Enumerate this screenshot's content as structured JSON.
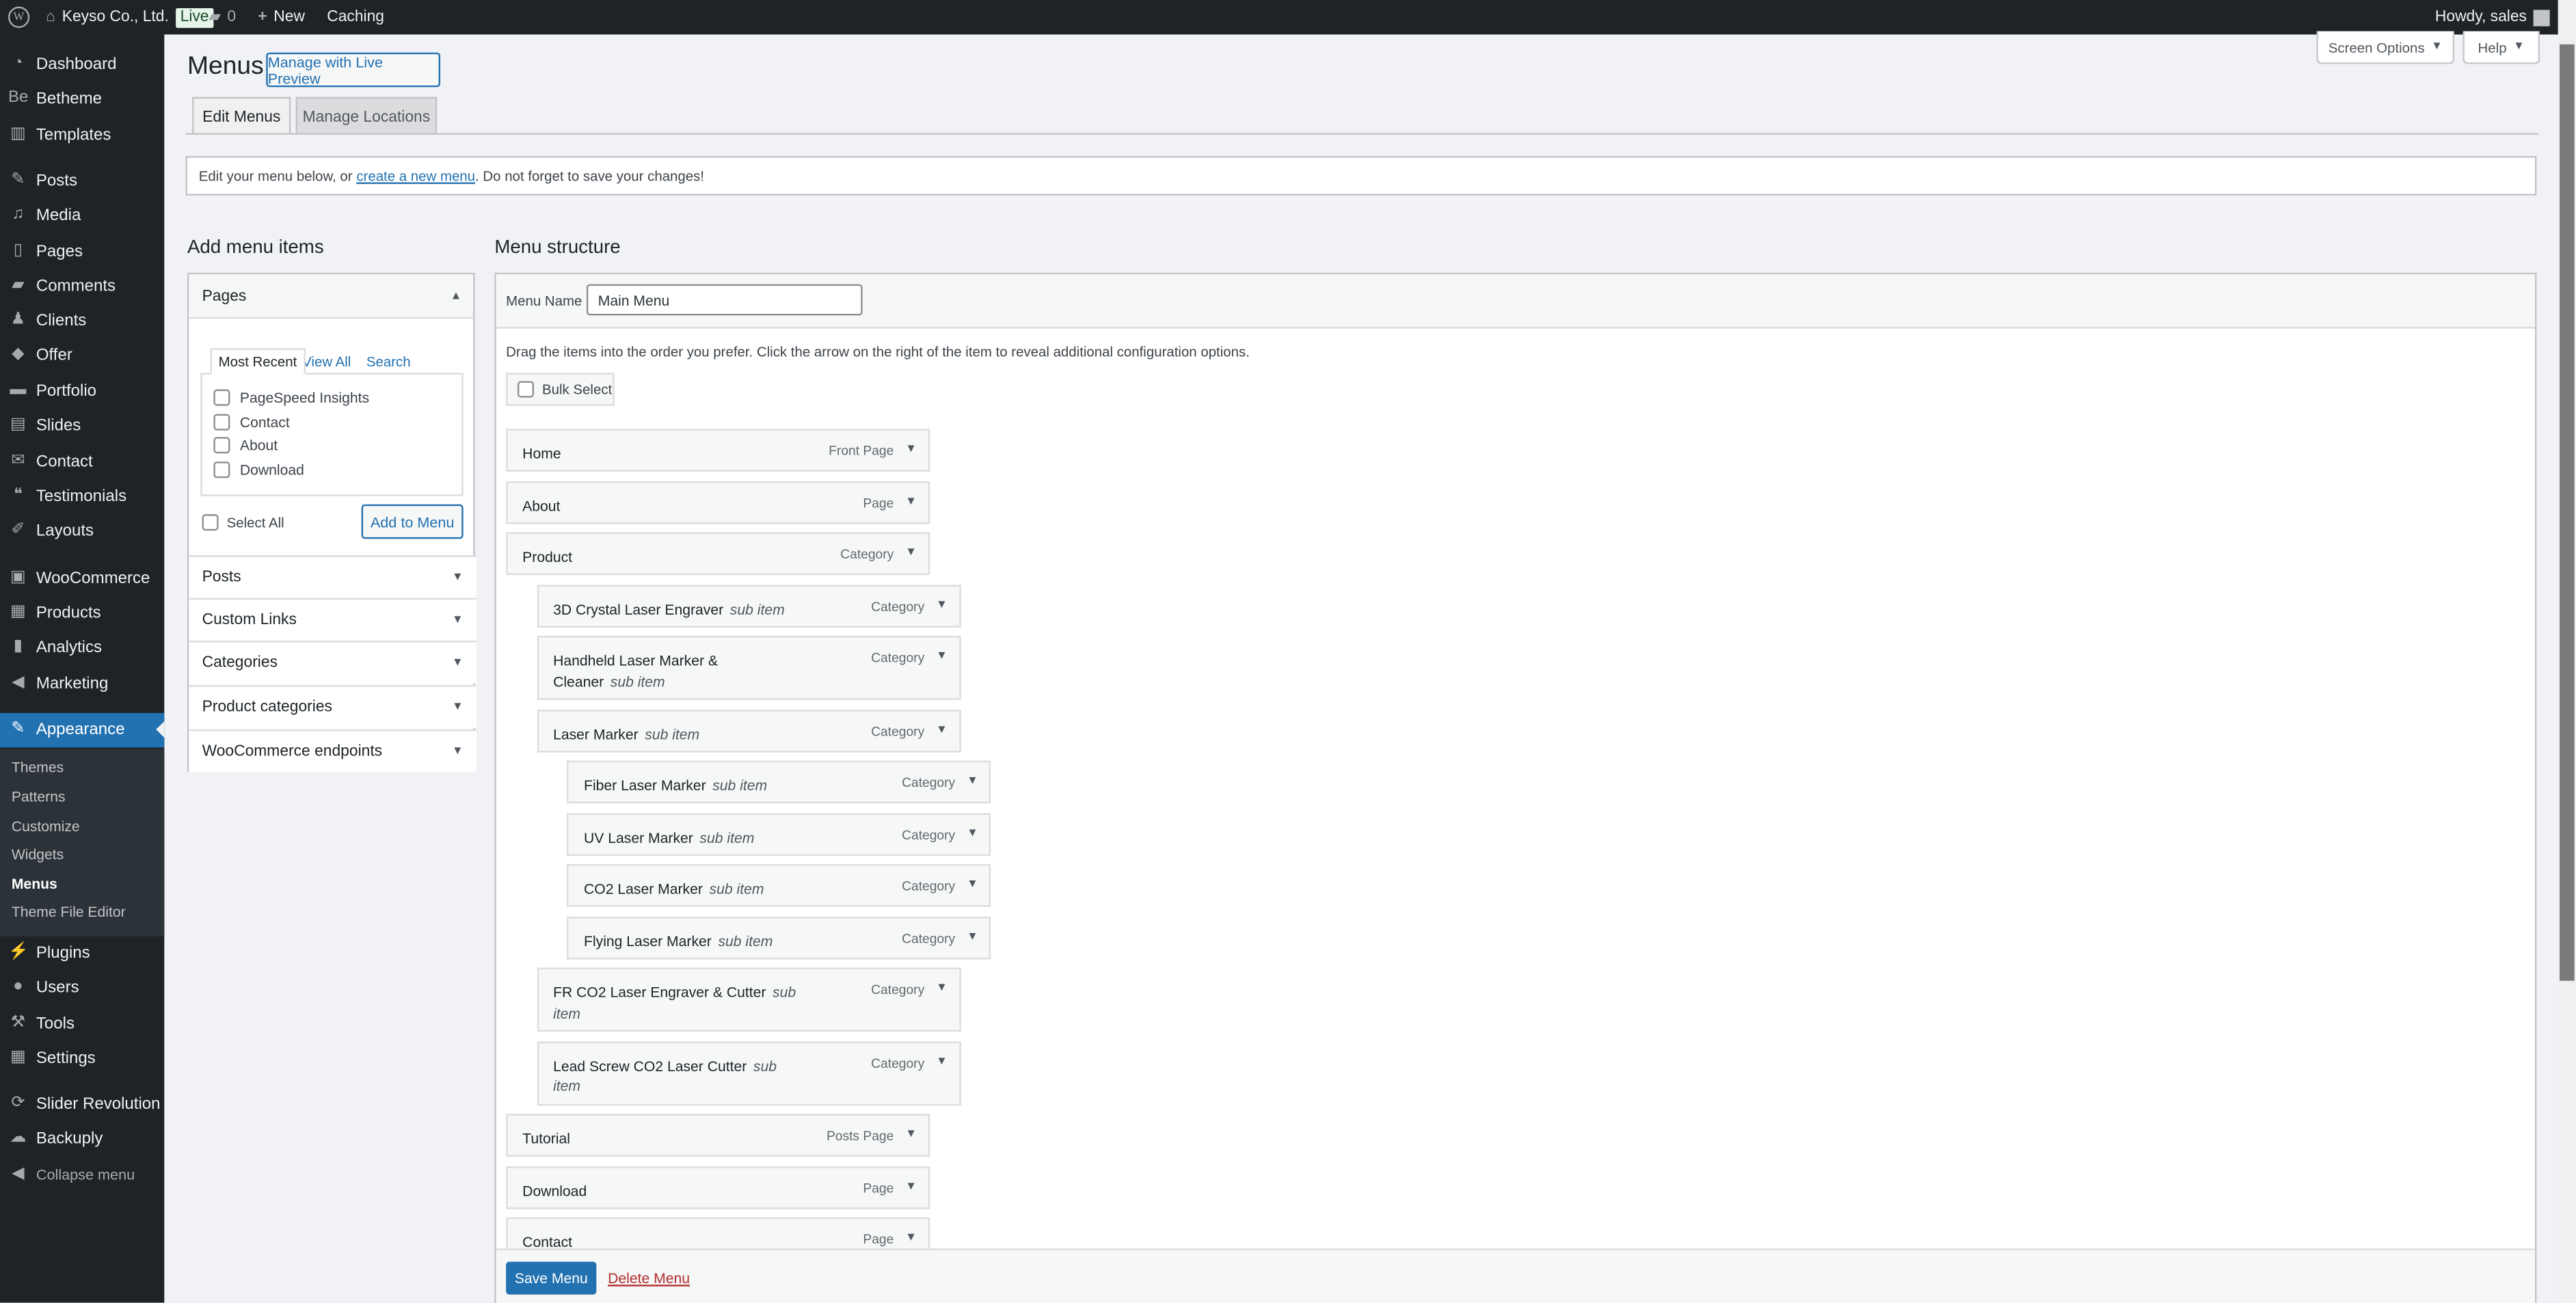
{
  "adminbar": {
    "site": "Keyso Co., Ltd.",
    "live": "Live",
    "comments": "0",
    "new": "New",
    "caching": "Caching",
    "howdy": "Howdy, sales"
  },
  "sidebar": {
    "items": [
      {
        "label": "Dashboard",
        "icon": "dashboard-icon",
        "glyph": "◔"
      },
      {
        "label": "Betheme",
        "icon": "betheme-icon",
        "glyph": "Be"
      },
      {
        "label": "Templates",
        "icon": "templates-icon",
        "glyph": "▥"
      },
      {
        "label": "Posts",
        "icon": "pin-icon",
        "glyph": "✎"
      },
      {
        "label": "Media",
        "icon": "media-icon",
        "glyph": "♫"
      },
      {
        "label": "Pages",
        "icon": "pages-icon",
        "glyph": "▯"
      },
      {
        "label": "Comments",
        "icon": "comment-icon",
        "glyph": "▰"
      },
      {
        "label": "Clients",
        "icon": "clients-icon",
        "glyph": "♟"
      },
      {
        "label": "Offer",
        "icon": "tag-icon",
        "glyph": "◆"
      },
      {
        "label": "Portfolio",
        "icon": "folder-icon",
        "glyph": "▬"
      },
      {
        "label": "Slides",
        "icon": "slides-icon",
        "glyph": "▤"
      },
      {
        "label": "Contact",
        "icon": "mail-icon",
        "glyph": "✉"
      },
      {
        "label": "Testimonials",
        "icon": "quote-icon",
        "glyph": "❝"
      },
      {
        "label": "Layouts",
        "icon": "pencil-icon",
        "glyph": "✐"
      },
      {
        "label": "WooCommerce",
        "icon": "woocommerce-icon",
        "glyph": "▣"
      },
      {
        "label": "Products",
        "icon": "products-icon",
        "glyph": "▦"
      },
      {
        "label": "Analytics",
        "icon": "chart-icon",
        "glyph": "▮"
      },
      {
        "label": "Marketing",
        "icon": "megaphone-icon",
        "glyph": "◀"
      },
      {
        "label": "Appearance",
        "icon": "brush-icon",
        "glyph": "✎"
      },
      {
        "label": "Plugins",
        "icon": "plugin-icon",
        "glyph": "⚡"
      },
      {
        "label": "Users",
        "icon": "user-icon",
        "glyph": "●"
      },
      {
        "label": "Tools",
        "icon": "wrench-icon",
        "glyph": "⚒"
      },
      {
        "label": "Settings",
        "icon": "settings-icon",
        "glyph": "▦"
      },
      {
        "label": "Slider Revolution",
        "icon": "refresh-icon",
        "glyph": "⟳"
      },
      {
        "label": "Backuply",
        "icon": "cloud-upload-icon",
        "glyph": "☁"
      }
    ],
    "submenu": [
      "Themes",
      "Patterns",
      "Customize",
      "Widgets",
      "Menus",
      "Theme File Editor"
    ],
    "current_submenu": "Menus",
    "collapse": "Collapse menu"
  },
  "header": {
    "title": "Menus",
    "live_preview": "Manage with Live Preview",
    "screen_options": "Screen Options",
    "help": "Help",
    "tabs": [
      "Edit Menus",
      "Manage Locations"
    ],
    "active_tab": "Edit Menus"
  },
  "notice": {
    "before": "Edit your menu below, or ",
    "link": "create a new menu",
    "after": ". Do not forget to save your changes!"
  },
  "add_items": {
    "title": "Add menu items",
    "pages": {
      "title": "Pages",
      "tabs": [
        "Most Recent",
        "View All",
        "Search"
      ],
      "active_tab": "Most Recent",
      "items": [
        "PageSpeed Insights",
        "Contact",
        "About",
        "Download"
      ],
      "select_all": "Select All",
      "add_button": "Add to Menu"
    },
    "sections": [
      "Posts",
      "Custom Links",
      "Categories",
      "Product categories",
      "WooCommerce endpoints"
    ]
  },
  "structure": {
    "title": "Menu structure",
    "name_label": "Menu Name",
    "name_value": "Main Menu",
    "instructions": "Drag the items into the order you prefer. Click the arrow on the right of the item to reveal additional configuration options.",
    "bulk_select": "Bulk Select",
    "sub_label": "sub item",
    "items": [
      {
        "title": "Home",
        "type": "Front Page",
        "depth": 0
      },
      {
        "title": "About",
        "type": "Page",
        "depth": 0
      },
      {
        "title": "Product",
        "type": "Category",
        "depth": 0
      },
      {
        "title": "3D Crystal Laser Engraver",
        "type": "Category",
        "depth": 1
      },
      {
        "title": "Handheld Laser Marker & Cleaner",
        "type": "Category",
        "depth": 1
      },
      {
        "title": "Laser Marker",
        "type": "Category",
        "depth": 1
      },
      {
        "title": "Fiber Laser Marker",
        "type": "Category",
        "depth": 2
      },
      {
        "title": "UV Laser Marker",
        "type": "Category",
        "depth": 2
      },
      {
        "title": "CO2 Laser Marker",
        "type": "Category",
        "depth": 2
      },
      {
        "title": "Flying Laser Marker",
        "type": "Category",
        "depth": 2
      },
      {
        "title": "FR CO2 Laser Engraver & Cutter",
        "type": "Category",
        "depth": 1
      },
      {
        "title": "Lead Screw CO2 Laser Cutter",
        "type": "Category",
        "depth": 1
      },
      {
        "title": "Tutorial",
        "type": "Posts Page",
        "depth": 0
      },
      {
        "title": "Download",
        "type": "Page",
        "depth": 0
      },
      {
        "title": "Contact",
        "type": "Page",
        "depth": 0
      }
    ],
    "save": "Save Menu",
    "delete": "Delete Menu"
  },
  "colors": {
    "accent": "#2271b1",
    "adminbar": "#1d2327",
    "delete": "#b32d2e"
  }
}
